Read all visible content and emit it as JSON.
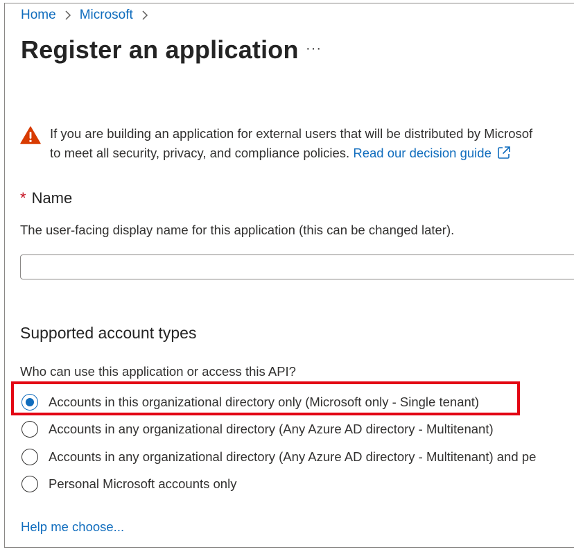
{
  "breadcrumb": {
    "items": [
      "Home",
      "Microsoft"
    ]
  },
  "page": {
    "title": "Register an application",
    "more_label": "···"
  },
  "warning": {
    "icon": "warning-triangle-icon",
    "line1": "If you are building an application for external users that will be distributed by Microsof",
    "line2_prefix": "to meet all security, privacy, and compliance policies. ",
    "link": "Read our decision guide",
    "link_icon": "open-in-new-window-icon"
  },
  "name_field": {
    "required_marker": "*",
    "label": "Name",
    "description": "The user-facing display name for this application (this can be changed later).",
    "value": "",
    "placeholder": ""
  },
  "account_types": {
    "title": "Supported account types",
    "question": "Who can use this application or access this API?",
    "options": [
      {
        "label": "Accounts in this organizational directory only (Microsoft only - Single tenant)",
        "selected": true
      },
      {
        "label": "Accounts in any organizational directory (Any Azure AD directory - Multitenant)",
        "selected": false
      },
      {
        "label": "Accounts in any organizational directory (Any Azure AD directory - Multitenant) and pe",
        "selected": false
      },
      {
        "label": "Personal Microsoft accounts only",
        "selected": false
      }
    ]
  },
  "help_link": "Help me choose...",
  "colors": {
    "link": "#0f6cbd",
    "warning": "#d83b01",
    "required": "#c50f1f",
    "highlight": "#e30613"
  }
}
